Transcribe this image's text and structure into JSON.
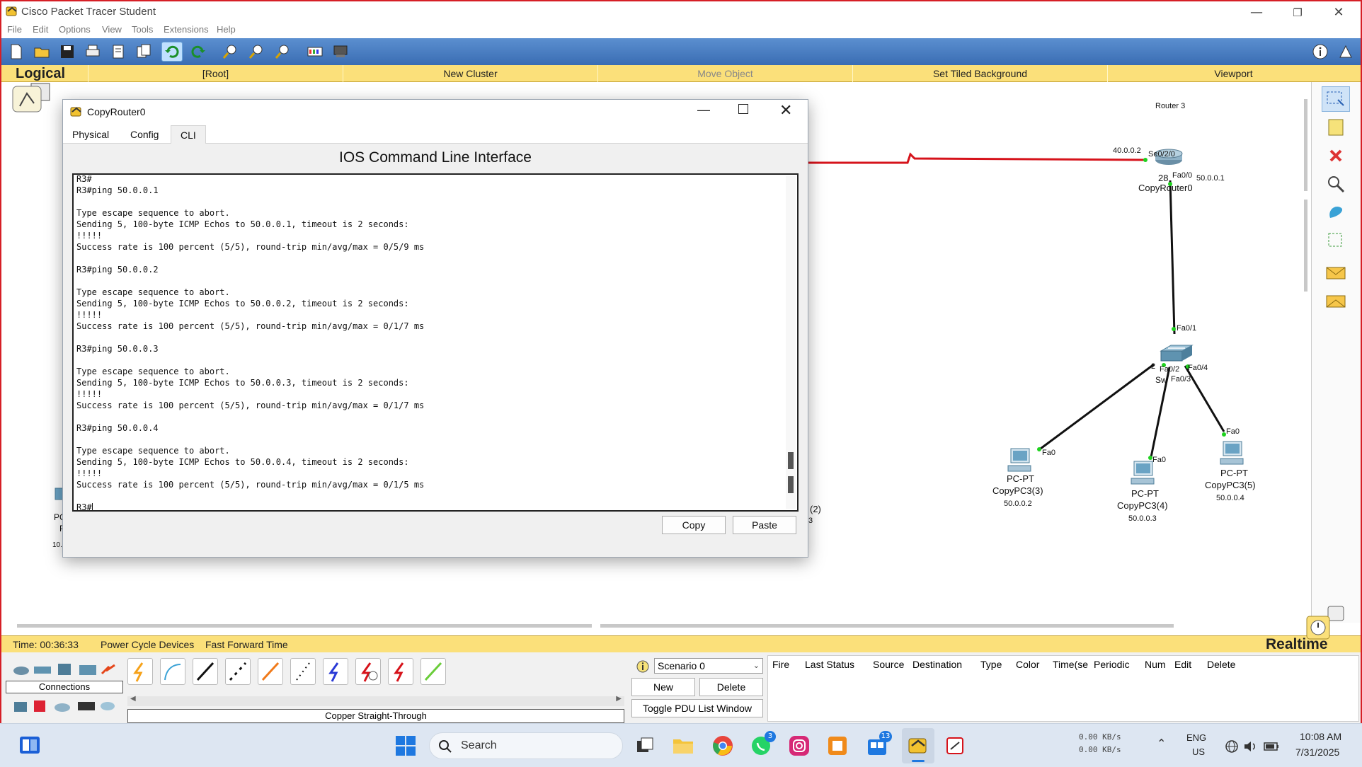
{
  "window": {
    "title": "Cisco Packet Tracer Student",
    "controls": [
      "—",
      "❐",
      "✕"
    ]
  },
  "menu": [
    "File",
    "Edit",
    "Options",
    "View",
    "Tools",
    "Extensions",
    "Help"
  ],
  "toolbar_icons": [
    "new-file-icon",
    "open-folder-icon",
    "save-icon",
    "print-icon",
    "activity-wizard-icon",
    "copy-icon",
    "undo-icon",
    "redo-icon",
    "zoom-in-icon",
    "zoom-reset-icon",
    "zoom-out-icon",
    "palette-icon",
    "custom-device-icon",
    "info-icon",
    "network-info-icon"
  ],
  "logical_bar": {
    "mode": "Logical",
    "items": [
      "[Root]",
      "New Cluster",
      "Move Object",
      "Set Tiled Background",
      "Viewport"
    ]
  },
  "topology": {
    "router_title": "Router 3",
    "router_name": "CopyRouter0",
    "router_model_partial": "28",
    "router_port_serial": "Se0/2/0",
    "router_serial_ip": "40.0.0.2",
    "router_port_fa": "Fa0/0",
    "router_fa_ip": "50.0.0.1",
    "switch_port_up": "Fa0/1",
    "switch_port_left": "Fa0/2",
    "switch_port_mid": "Fa0/3",
    "switch_port_right": "Fa0/4",
    "switch_label_partial": "Sw",
    "switch_left_partial": "2",
    "pcs": [
      {
        "type": "PC-PT",
        "name": "CopyPC3(3)",
        "ip": "50.0.0.2",
        "port": "Fa0"
      },
      {
        "type": "PC-PT",
        "name": "CopyPC3(4)",
        "ip": "50.0.0.3",
        "port": "Fa0"
      },
      {
        "type": "PC-PT",
        "name": "CopyPC3(5)",
        "ip": "50.0.0.4",
        "port": "Fa0"
      }
    ],
    "hidden_left": {
      "pc_partial": "PC",
      "p_partial": "P",
      "ip_partial": "10."
    },
    "hidden_mid": {
      "label_partial": "(2)",
      "sub_partial": "3"
    }
  },
  "dialog": {
    "title": "CopyRouter0",
    "tabs": [
      "Physical",
      "Config",
      "CLI"
    ],
    "active_tab": "CLI",
    "heading": "IOS Command Line Interface",
    "cli_lines": [
      "R3#",
      "R3#ping 50.0.0.1",
      "",
      "Type escape sequence to abort.",
      "Sending 5, 100-byte ICMP Echos to 50.0.0.1, timeout is 2 seconds:",
      "!!!!!",
      "Success rate is 100 percent (5/5), round-trip min/avg/max = 0/5/9 ms",
      "",
      "R3#ping 50.0.0.2",
      "",
      "Type escape sequence to abort.",
      "Sending 5, 100-byte ICMP Echos to 50.0.0.2, timeout is 2 seconds:",
      "!!!!!",
      "Success rate is 100 percent (5/5), round-trip min/avg/max = 0/1/7 ms",
      "",
      "R3#ping 50.0.0.3",
      "",
      "Type escape sequence to abort.",
      "Sending 5, 100-byte ICMP Echos to 50.0.0.3, timeout is 2 seconds:",
      "!!!!!",
      "Success rate is 100 percent (5/5), round-trip min/avg/max = 0/1/7 ms",
      "",
      "R3#ping 50.0.0.4",
      "",
      "Type escape sequence to abort.",
      "Sending 5, 100-byte ICMP Echos to 50.0.0.4, timeout is 2 seconds:",
      "!!!!!",
      "Success rate is 100 percent (5/5), round-trip min/avg/max = 0/1/5 ms",
      "",
      "R3#"
    ],
    "copy_label": "Copy",
    "paste_label": "Paste"
  },
  "status": {
    "time": "Time: 00:36:33",
    "power_cycle": "Power Cycle Devices",
    "fast_forward": "Fast Forward Time",
    "mode": "Realtime"
  },
  "bottom": {
    "connections_label": "Connections",
    "cable_label": "Copper Straight-Through",
    "scenario": "Scenario 0",
    "new_label": "New",
    "delete_label": "Delete",
    "toggle_label": "Toggle PDU List Window",
    "pdu_columns": [
      "Fire",
      "Last Status",
      "Source",
      "Destination",
      "Type",
      "Color",
      "Time(se",
      "Periodic",
      "Num",
      "Edit",
      "Delete"
    ]
  },
  "taskbar": {
    "search_placeholder": "Search",
    "net_up": "0.00 KB/s",
    "net_down": "0.00 KB/s",
    "lang": "ENG",
    "region": "US",
    "time": "10:08 AM",
    "date": "7/31/2025",
    "whatsapp_badge": "3",
    "teams_badge": "13"
  },
  "colors": {
    "serial_link": "#d6131b",
    "logical_bar": "#fbe07a",
    "toolbar": "#4a7ec4",
    "link_up": "#1fd21f"
  }
}
